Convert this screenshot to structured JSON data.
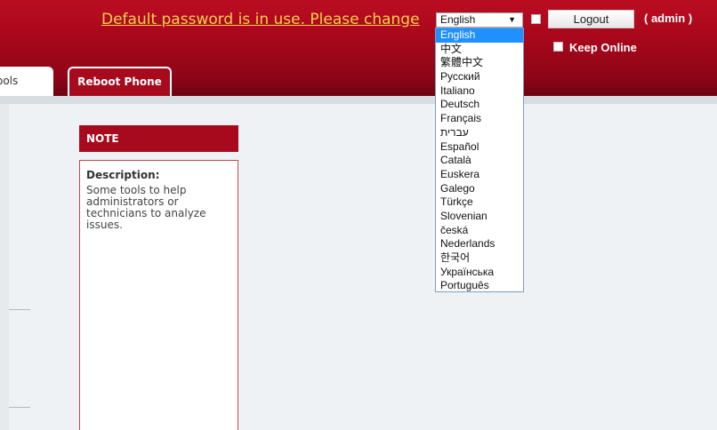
{
  "header": {
    "warning": "Default password is in use. Please change",
    "logout_label": "Logout",
    "user_label": "( admin )",
    "keep_online_label": "Keep Online"
  },
  "language": {
    "selected": "English",
    "options": [
      "English",
      "中文",
      "繁體中文",
      "Русский",
      "Italiano",
      "Deutsch",
      "Français",
      "עברית",
      "Español",
      "Català",
      "Euskera",
      "Galego",
      "Türkçe",
      "Slovenian",
      "česká",
      "Nederlands",
      "한국어",
      "Українська",
      "Português"
    ]
  },
  "tabs": [
    {
      "label": "ools"
    },
    {
      "label": "Reboot Phone"
    }
  ],
  "note": {
    "heading": "NOTE",
    "title": "Description:",
    "text": "Some tools to help administrators or technicians to analyze issues."
  },
  "colors": {
    "brand_red": "#a80a1d",
    "warning_yellow": "#f3d24a",
    "selection_blue": "#1e90ff"
  }
}
